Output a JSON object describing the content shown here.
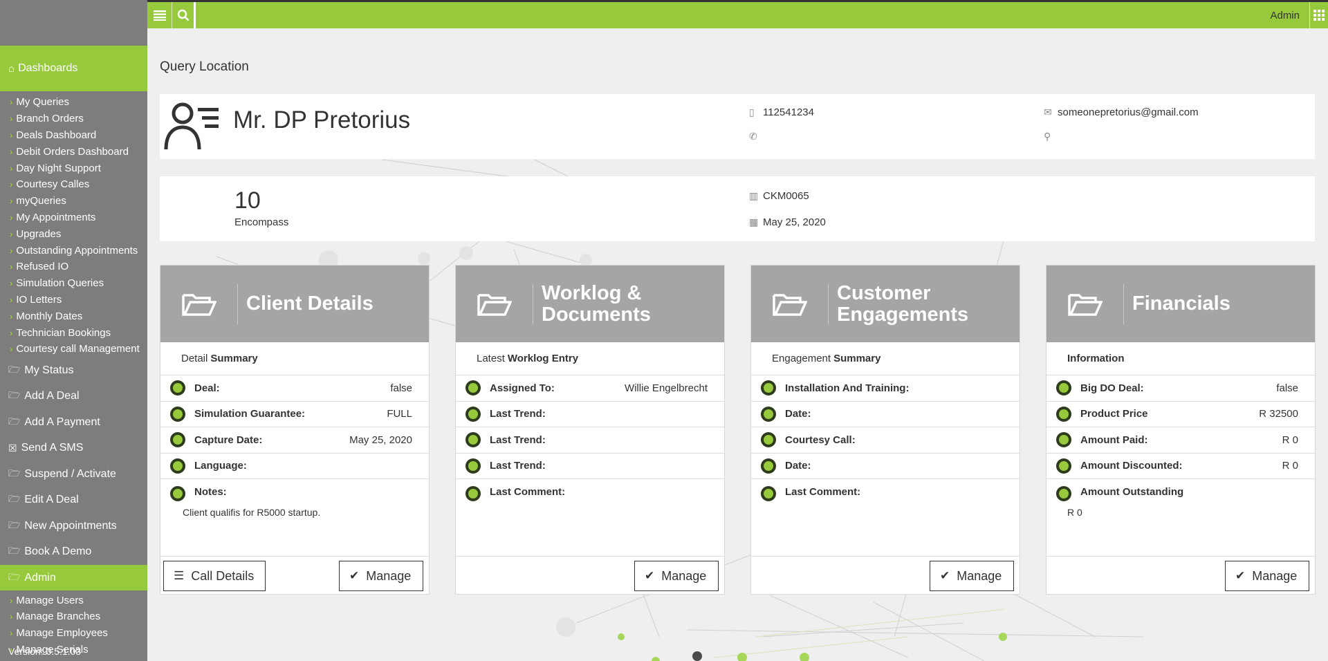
{
  "topbar": {
    "admin_label": "Admin"
  },
  "sidebar": {
    "active_section": "Dashboards",
    "dashboard_items": [
      "My Queries",
      "Branch Orders",
      "Deals Dashboard",
      "Debit Orders Dashboard",
      "Day Night Support",
      "Courtesy Calles",
      "myQueries",
      "My Appointments",
      "Upgrades",
      "Outstanding Appointments",
      "Refused IO",
      "Simulation Queries",
      "IO Letters",
      "Monthly Dates",
      "Technician Bookings",
      "Courtesy call Management"
    ],
    "main_items": [
      "My Status",
      "Add A Deal",
      "Add A Payment",
      "Send A SMS",
      "Suspend / Activate",
      "Edit A Deal",
      "New Appointments",
      "Book A Demo"
    ],
    "admin_label": "Admin",
    "admin_items": [
      "Manage Users",
      "Manage Branches",
      "Manage Employees",
      "Manage Serials"
    ],
    "version": "Version: 0.5.1.03"
  },
  "page": {
    "title": "Query Location"
  },
  "person": {
    "name": "Mr. DP Pretorius",
    "mobile": "112541234",
    "phone": "",
    "email": "someonepretorius@gmail.com",
    "location": ""
  },
  "deal": {
    "number": "10",
    "brand": "Encompass",
    "serial": "CKM0065",
    "date": "May 25, 2020"
  },
  "cards": {
    "client": {
      "title": "Client Details",
      "sub_prefix": "Detail",
      "sub_bold": "Summary",
      "rows": [
        {
          "label": "Deal:",
          "value": "false"
        },
        {
          "label": "Simulation Guarantee:",
          "value": "FULL"
        },
        {
          "label": "Capture Date:",
          "value": "May 25, 2020"
        },
        {
          "label": "Language:",
          "value": ""
        }
      ],
      "notes_label": "Notes:",
      "notes_value": "Client qualifis for R5000 startup.",
      "call_button": "Call Details",
      "manage_button": "Manage"
    },
    "worklog": {
      "title_line1": "Worklog &",
      "title_line2": "Documents",
      "sub_prefix": "Latest",
      "sub_bold": "Worklog Entry",
      "rows": [
        {
          "label": "Assigned To:",
          "value": "Willie Engelbrecht"
        },
        {
          "label": "Last Trend:",
          "value": ""
        },
        {
          "label": "Last Trend:",
          "value": ""
        },
        {
          "label": "Last Trend:",
          "value": ""
        }
      ],
      "last_label": "Last Comment:",
      "manage_button": "Manage"
    },
    "engagements": {
      "title_line1": "Customer",
      "title_line2": "Engagements",
      "sub_prefix": "Engagement",
      "sub_bold": "Summary",
      "rows": [
        {
          "label": "Installation And Training:",
          "value": ""
        },
        {
          "label": "Date:",
          "value": ""
        },
        {
          "label": "Courtesy Call:",
          "value": ""
        },
        {
          "label": "Date:",
          "value": ""
        }
      ],
      "last_label": "Last Comment:",
      "manage_button": "Manage"
    },
    "financials": {
      "title": "Financials",
      "sub_prefix": "",
      "sub_bold": "Information",
      "rows": [
        {
          "label": "Big DO Deal:",
          "value": "false"
        },
        {
          "label": "Product Price",
          "value": "R 32500"
        },
        {
          "label": "Amount Paid:",
          "value": "R 0"
        },
        {
          "label": "Amount Discounted:",
          "value": "R 0"
        }
      ],
      "last_label": "Amount Outstanding",
      "last_value": "R 0",
      "manage_button": "Manage"
    }
  },
  "colors": {
    "accent": "#97c93d",
    "sidebar": "#7d7d7d",
    "card_header": "#a5a5a5",
    "background": "#efefef"
  }
}
